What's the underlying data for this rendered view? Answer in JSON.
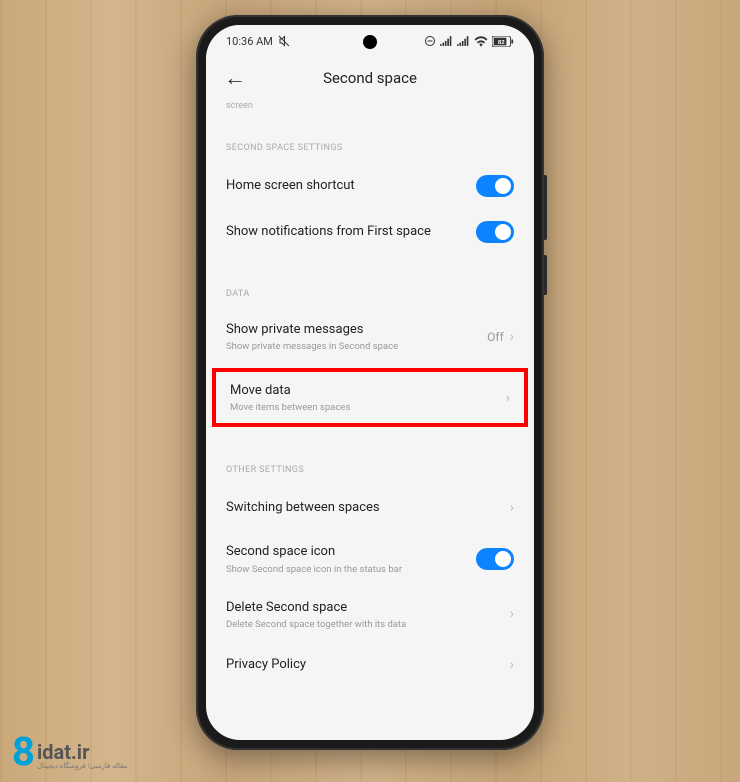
{
  "status": {
    "time": "10:36 AM",
    "mute": "🔕",
    "battery": "82"
  },
  "header": {
    "title": "Second space"
  },
  "remnant": "screen",
  "sections": {
    "s1": {
      "header": "SECOND SPACE SETTINGS",
      "items": {
        "home_shortcut": "Home screen shortcut",
        "show_notif": "Show notifications from First space"
      }
    },
    "s2": {
      "header": "DATA",
      "items": {
        "private_msg": {
          "title": "Show private messages",
          "subtitle": "Show private messages in Second space",
          "value": "Off"
        },
        "move_data": {
          "title": "Move data",
          "subtitle": "Move items between spaces"
        }
      }
    },
    "s3": {
      "header": "OTHER SETTINGS",
      "items": {
        "switching": "Switching between spaces",
        "icon": {
          "title": "Second space icon",
          "subtitle": "Show Second space icon in the status bar"
        },
        "delete": {
          "title": "Delete Second space",
          "subtitle": "Delete Second space together with its data"
        },
        "privacy": "Privacy Policy"
      }
    }
  },
  "watermark": {
    "num": "8",
    "main": "idat.ir",
    "sub": "مقاله فارسی؛ فروشگاه دیجیتال"
  }
}
